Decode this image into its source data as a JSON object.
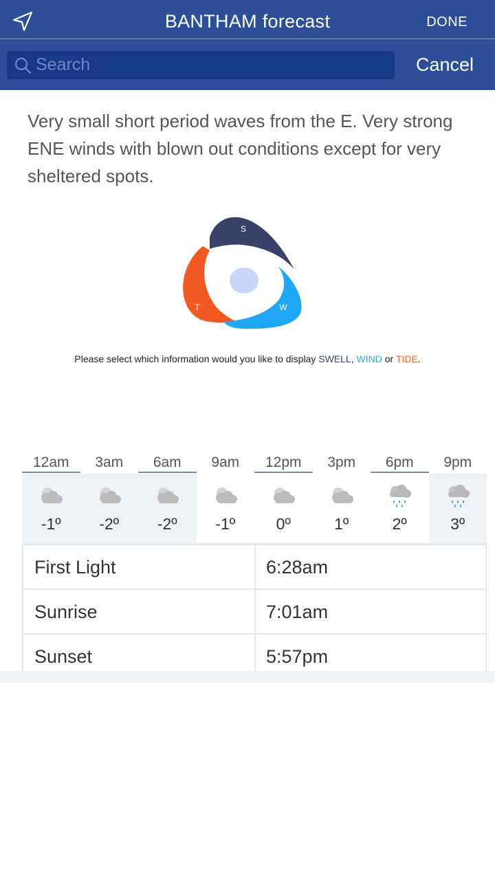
{
  "header": {
    "title": "BANTHAM forecast",
    "done_label": "DONE",
    "cancel_label": "Cancel",
    "search_placeholder": "Search",
    "background_color": "#2d4f9a"
  },
  "forecast": {
    "description": "Very small short period waves from the E. Very strong ENE winds with blown out conditions except for very sheltered spots."
  },
  "compass": {
    "swell_letter": "S",
    "wind_letter": "W",
    "tide_letter": "T",
    "swell_color": "#3a4169",
    "wind_color": "#1ea7f5",
    "tide_color": "#f05a22",
    "center_color": "#c8d6fa"
  },
  "prompt": {
    "text_before": "Please select which information would you like to display ",
    "swell": "SWELL",
    "comma": ", ",
    "wind": "WIND",
    "or": " or ",
    "tide": "TIDE",
    "end": "."
  },
  "hourly": [
    {
      "time": "12am",
      "temp": "-1º",
      "icon": "cloud-icon"
    },
    {
      "time": "3am",
      "temp": "-2º",
      "icon": "cloud-icon"
    },
    {
      "time": "6am",
      "temp": "-2º",
      "icon": "cloud-icon"
    },
    {
      "time": "9am",
      "temp": "-1º",
      "icon": "cloud-icon"
    },
    {
      "time": "12pm",
      "temp": "0º",
      "icon": "cloud-icon"
    },
    {
      "time": "3pm",
      "temp": "1º",
      "icon": "cloud-icon"
    },
    {
      "time": "6pm",
      "temp": "2º",
      "icon": "rain-cloud-icon"
    },
    {
      "time": "9pm",
      "temp": "3º",
      "icon": "rain-cloud-icon"
    }
  ],
  "sun_times": [
    {
      "label": "First Light",
      "value": "6:28am"
    },
    {
      "label": "Sunrise",
      "value": "7:01am"
    },
    {
      "label": "Sunset",
      "value": "5:57pm"
    }
  ]
}
